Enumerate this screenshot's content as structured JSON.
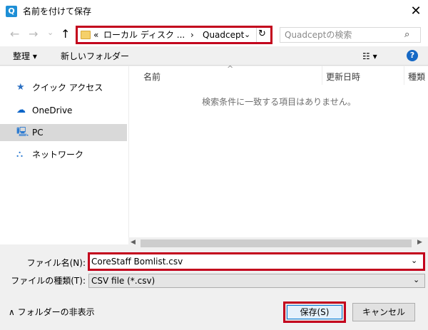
{
  "window": {
    "title": "名前を付けて保存",
    "app_icon_letter": "Q",
    "close_glyph": "✕"
  },
  "nav": {
    "back_glyph": "←",
    "forward_glyph": "→",
    "recent_glyph": "⌄",
    "up_glyph": "↑",
    "address": {
      "prefix": "«",
      "crumb1": "ローカル ディスク ...",
      "sep": "›",
      "crumb2": "Quadcept",
      "chevron": "⌄",
      "refresh_glyph": "↻"
    },
    "search": {
      "placeholder": "Quadceptの検索",
      "icon": "⌕"
    }
  },
  "toolbar": {
    "organize_label": "整理 ▾",
    "new_folder_label": "新しいフォルダー",
    "view_label": "☷ ▾",
    "help_glyph": "?"
  },
  "sidebar": {
    "items": [
      {
        "icon": "★",
        "label": "クイック アクセス"
      },
      {
        "icon": "☁",
        "label": "OneDrive"
      },
      {
        "icon": "🖳",
        "label": "PC"
      },
      {
        "icon": "⛬",
        "label": "ネットワーク"
      }
    ]
  },
  "filelist": {
    "sort_caret": "^",
    "columns": [
      "名前",
      "更新日時",
      "種類"
    ],
    "empty_message": "検索条件に一致する項目はありません。"
  },
  "hscroll": {
    "left_glyph": "◀",
    "right_glyph": "▶"
  },
  "form": {
    "filename_label": "ファイル名(N):",
    "filename_value": "CoreStaff Bomlist.csv",
    "filename_chev": "⌄",
    "filetype_label": "ファイルの種類(T):",
    "filetype_value": "CSV file (*.csv)",
    "filetype_chev": "⌄",
    "hide_folders_label": "∧ フォルダーの非表示",
    "save_label": "保存(S)",
    "cancel_label": "キャンセル"
  },
  "colors": {
    "highlight_red": "#c3001c",
    "help_blue": "#1669c5",
    "focus_blue": "#0078d7"
  }
}
